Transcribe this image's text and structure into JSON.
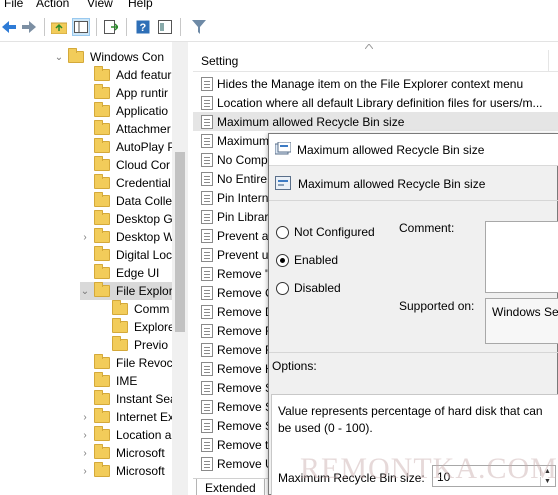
{
  "menu": {
    "file": "File",
    "action": "Action",
    "view": "View",
    "help": "Help"
  },
  "tree": {
    "items": [
      {
        "label": "Windows Con",
        "chev": "⌄",
        "indent": 0
      },
      {
        "label": "Add featur",
        "chev": "",
        "indent": 1
      },
      {
        "label": "App runtir",
        "chev": "",
        "indent": 1
      },
      {
        "label": "Applicatio",
        "chev": "",
        "indent": 1
      },
      {
        "label": "Attachmer",
        "chev": "",
        "indent": 1
      },
      {
        "label": "AutoPlay P",
        "chev": "",
        "indent": 1
      },
      {
        "label": "Cloud Cor",
        "chev": "",
        "indent": 1
      },
      {
        "label": "Credential",
        "chev": "",
        "indent": 1
      },
      {
        "label": "Data Colle",
        "chev": "",
        "indent": 1
      },
      {
        "label": "Desktop G",
        "chev": "",
        "indent": 1
      },
      {
        "label": "Desktop W",
        "chev": "›",
        "indent": 1
      },
      {
        "label": "Digital Loc",
        "chev": "",
        "indent": 1
      },
      {
        "label": "Edge UI",
        "chev": "",
        "indent": 1
      },
      {
        "label": "File Explor",
        "chev": "⌄",
        "indent": 1
      },
      {
        "label": "Comm",
        "chev": "",
        "indent": 2
      },
      {
        "label": "Explore",
        "chev": "",
        "indent": 2
      },
      {
        "label": "Previo",
        "chev": "",
        "indent": 2
      },
      {
        "label": "File Revoc",
        "chev": "",
        "indent": 1
      },
      {
        "label": "IME",
        "chev": "",
        "indent": 1
      },
      {
        "label": "Instant Sea",
        "chev": "",
        "indent": 1
      },
      {
        "label": "Internet Ex",
        "chev": "›",
        "indent": 1
      },
      {
        "label": "Location a",
        "chev": "›",
        "indent": 1
      },
      {
        "label": "Microsoft",
        "chev": "›",
        "indent": 1
      },
      {
        "label": "Microsoft",
        "chev": "›",
        "indent": 1
      }
    ]
  },
  "list": {
    "header": "Setting",
    "rows": [
      "Hides the Manage item on the File Explorer context menu",
      "Location where all default Library definition files for users/m...",
      "Maximum allowed Recycle Bin size",
      "Maximum",
      "No Comp",
      "No Entire",
      "Pin Intern",
      "Pin Librar",
      "Prevent a",
      "Prevent u",
      "Remove \"",
      "Remove C",
      "Remove D",
      "Remove F",
      "Remove F",
      "Remove H",
      "Remove S",
      "Remove S",
      "Remove S",
      "Remove th",
      "Remove U"
    ],
    "tab": "Extended"
  },
  "dialog": {
    "title": "Maximum allowed Recycle Bin size",
    "heading": "Maximum allowed Recycle Bin size",
    "radio_not_configured": "Not Configured",
    "radio_enabled": "Enabled",
    "radio_disabled": "Disabled",
    "comment_label": "Comment:",
    "supported_label": "Supported on:",
    "supported_value": "Windows Ser",
    "options_label": "Options:",
    "desc": "Value represents percentage of hard disk that can be used (0 - 100).",
    "field_label": "Maximum Recycle Bin size:",
    "field_value": "10",
    "selected": "Enabled"
  },
  "watermark": "REMONTKA.COM"
}
